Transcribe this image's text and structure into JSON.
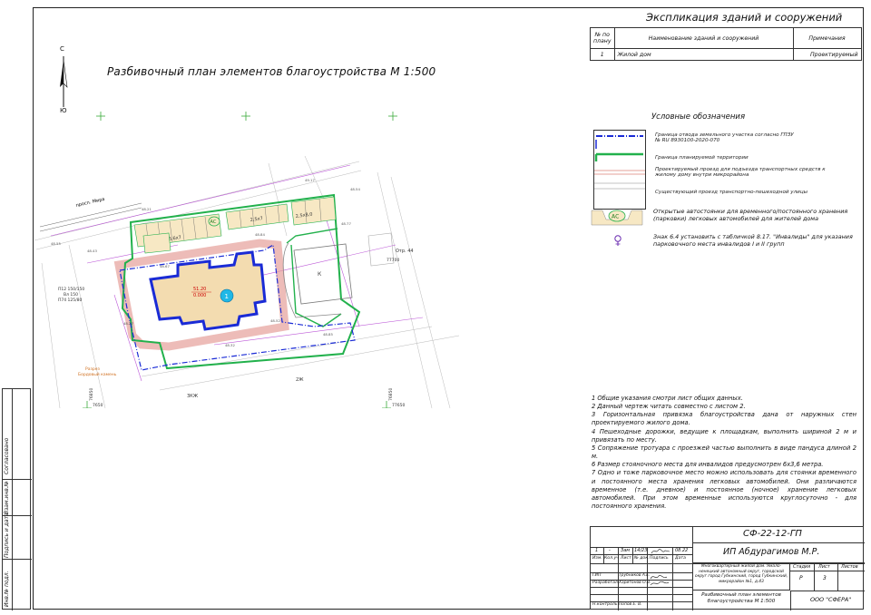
{
  "plan": {
    "title": "Разбивочный план элементов благоустройства М 1:500",
    "north_top": "С",
    "north_bottom": "Ю",
    "street": "просп. Мира",
    "label_otr": "Отр. 44",
    "label_3kzh": "3КЖ",
    "label_2zh": "2Ж",
    "label_k": "К",
    "building_number": "1",
    "level_top": "51.20",
    "level_bottom": "0.000",
    "parking_label": "АС",
    "parking_dims_1": "2,5x7",
    "parking_dims_2": "3,6x7",
    "parking_dims_3": "2,5x8,0",
    "coord_left_1": "76850",
    "coord_left_2": "7650",
    "coord_right_1": "76850",
    "coord_right_2": "77650",
    "coord_top_right": "77700",
    "left_info_1": "П12 150/150",
    "left_info_2": "Вл 150",
    "left_info_3": "П74 125/80",
    "walk_label_1": "Разрез",
    "walk_label_2": "Бордовый камень"
  },
  "explication": {
    "title": "Экспликация зданий и сооружений",
    "headers": [
      "№ по плану",
      "Наименование зданий и сооружений",
      "Примечания"
    ],
    "rows": [
      [
        "1",
        "Жилой дом",
        "Проектируемый"
      ]
    ]
  },
  "legend": {
    "title": "Условные обозначения",
    "items": [
      "Граница отвода земельного участка согласно ГПЗУ № RU 8930100-2020-070",
      "Граница планируемой территории",
      "Проектируемый проезд для подъезда транспортных средств к жилому дому внутри микрорайона",
      "Существующий проезд транспортно-пешеходной улицы",
      "Открытые автостоянки для временного/постоянного хранения (парковки) легковых автомобилей для жителей дома",
      "Знак 6.4 установить с табличкой 8.17. \"Инвалиды\" для указания парковочного места инвалидов I и II групп"
    ],
    "parking_symbol": "АС"
  },
  "notes": [
    "1 Общие указания смотри лист общих данных.",
    "2 Данный чертеж читать совместно с листом 2.",
    "3 Горизонтальная привязка благоустройства дана от наружных стен проектируемого жилого дома.",
    "4 Пешеходные дорожки, ведущие к площадкам, выполнить шириной 2 м и привязать по месту.",
    "5 Сопряжение тротуара с проезжей частью выполнить в виде пандуса длиной 2 м.",
    "6 Размер стояночного места для инвалидов предусмотрен 6х3,6 метра.",
    "7 Одно и тоже парковочное место можно использовать для стоянки временного и постоянного места хранения легковых автомобилей. Они различаются временное (т.е. дневное) и постоянное (ночное) хранение легковых автомобилей. При этом временные используются круглосуточно - для постоянного хранения."
  ],
  "titleblock": {
    "code": "СФ-22-12-ГП",
    "company_person": "ИП Абдурагимов М.Р.",
    "change_row": [
      "1",
      "-",
      "Зам",
      "14/23",
      "",
      "08.22"
    ],
    "headers": [
      "Изм.",
      "Кол.уч",
      "Лист",
      "№ док.",
      "Подпись",
      "Дата"
    ],
    "roles": [
      {
        "role": "ГИП",
        "name": "Трубников А.Е."
      },
      {
        "role": "Разработал",
        "name": "Харитонов О.В."
      },
      {
        "role": "",
        "name": ""
      },
      {
        "role": "Н.контроль",
        "name": "Попов Е. В."
      }
    ],
    "object": "Многоквартирный жилой дом. Ямало-ненецкий автономный округ, городской округ город Губкинский, город Губкинский, микрорайон №1, д.43",
    "stage_headers": [
      "Стадия",
      "Лист",
      "Листов"
    ],
    "stage_values": [
      "Р",
      "3",
      ""
    ],
    "sheet_title": "Разбивочный план элементов благоустройства М 1:500",
    "org": "ООО \"СФЕРА\""
  },
  "stamp": {
    "fields": [
      "Взам.инв.№",
      "Подпись и дата",
      "Инв.№ подл.",
      "Согласовано"
    ]
  },
  "colors": {
    "boundary_blue": "#1a2bd6",
    "plan_green": "#22b14c",
    "road_pink": "#e6a09a",
    "building_fill": "#f3dcb0",
    "parking_fill": "#f7e8c4",
    "cyan_marker": "#1fb8e6",
    "survey_magenta": "#b13bd1"
  }
}
